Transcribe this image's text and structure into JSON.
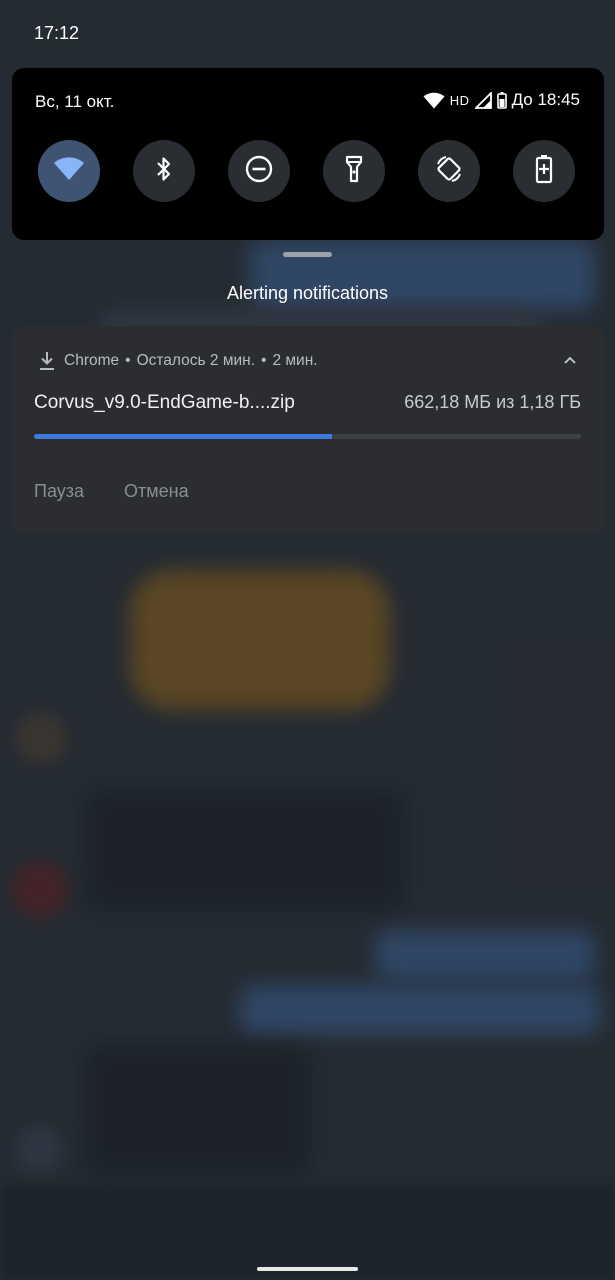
{
  "status_bar": {
    "time": "17:12"
  },
  "quick_settings": {
    "date": "Вс, 11 окт.",
    "network_type": "HD",
    "battery_estimate": "До 18:45",
    "tiles": [
      {
        "name": "wifi-tile",
        "icon": "wifi-icon",
        "active": true
      },
      {
        "name": "bluetooth-tile",
        "icon": "bluetooth-icon",
        "active": false
      },
      {
        "name": "dnd-tile",
        "icon": "do-not-disturb-icon",
        "active": false
      },
      {
        "name": "flashlight-tile",
        "icon": "flashlight-icon",
        "active": false
      },
      {
        "name": "autorotate-tile",
        "icon": "auto-rotate-icon",
        "active": false
      },
      {
        "name": "battery-saver-tile",
        "icon": "battery-saver-icon",
        "active": false
      }
    ]
  },
  "notifications": {
    "section_title": "Alerting notifications",
    "download": {
      "app_name": "Chrome",
      "separator": "•",
      "time_left": "Осталось 2 мин.",
      "age": "2 мин.",
      "file_name": "Corvus_v9.0-EndGame-b....zip",
      "size_progress": "662,18 МБ из 1,18 ГБ",
      "progress_fraction": 0.545,
      "actions": {
        "pause": "Пауза",
        "cancel": "Отмена"
      }
    }
  },
  "colors": {
    "accent": "#3b7bdd",
    "active_tile": "#3f5472",
    "panel_bg": "#000000",
    "card_bg": "#2b2d30"
  }
}
